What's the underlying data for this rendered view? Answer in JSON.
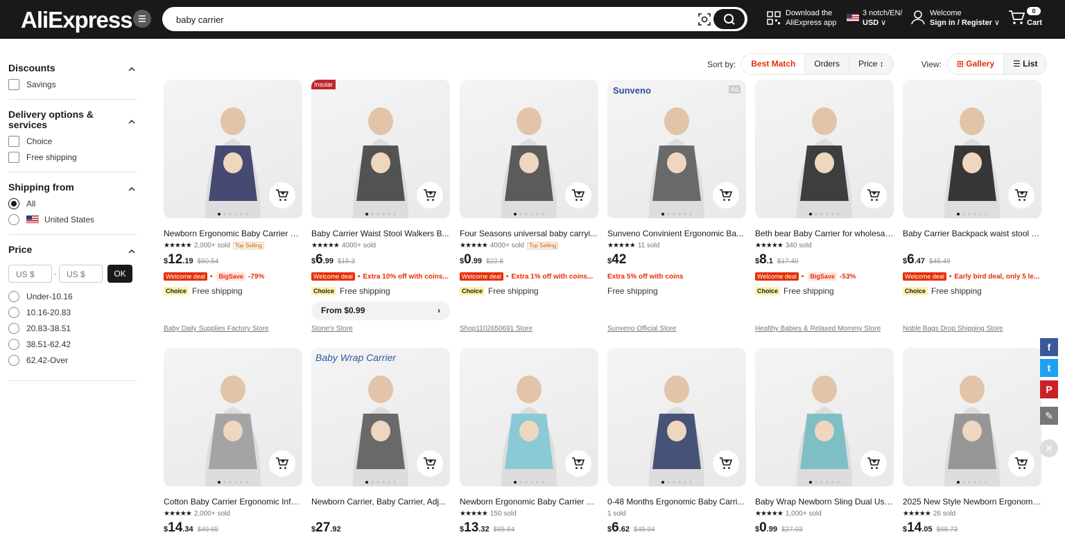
{
  "header": {
    "logo": "AliExpress",
    "search_value": "baby carrier",
    "download_line1": "Download the",
    "download_line2": "AliExpress app",
    "region_line1": "3 notch/EN/",
    "region_line2": "USD",
    "welcome_line1": "Welcome",
    "welcome_line2": "Sign in / Register",
    "cart_count": "0",
    "cart_label": "Cart"
  },
  "filters": {
    "discounts_title": "Discounts",
    "savings": "Savings",
    "delivery_title": "Delivery options & services",
    "choice": "Choice",
    "free_shipping": "Free shipping",
    "shipping_title": "Shipping from",
    "all": "All",
    "us": "United States",
    "price_title": "Price",
    "min_ph": "US $",
    "dash": "-",
    "max_ph": "US $",
    "ok": "OK",
    "ranges": [
      "Under-10.16",
      "10.16-20.83",
      "20.83-38.51",
      "38.51-62.42",
      "62.42-Over"
    ]
  },
  "sort": {
    "label": "Sort by:",
    "best": "Best Match",
    "orders": "Orders",
    "price": "Price",
    "view": "View:",
    "gallery": "Gallery",
    "list": "List"
  },
  "products": [
    {
      "title": "Newborn Ergonomic Baby Carrier B...",
      "sold": "2,000+ sold",
      "badge": "Top Selling",
      "cur": "$",
      "int": "12",
      "cent": ".19",
      "old": "$60.54",
      "promo": [
        "Welcome deal",
        "BigSave",
        "-79%"
      ],
      "ship": "Free shipping",
      "choice": "Choice",
      "store": "Baby Daily Supplies Factory Store",
      "accent": "#2b2f5e"
    },
    {
      "title": "Baby Carrier Waist Stool Walkers B...",
      "sold": "4000+ sold",
      "badge": "",
      "cur": "$",
      "int": "6",
      "cent": ".99",
      "old": "$15.3",
      "promo": [
        "Welcome deal",
        "",
        "Extra 10% off with coins..."
      ],
      "ship": "Free shipping",
      "choice": "Choice",
      "from": "From $0.99",
      "store": "Stone's Store",
      "accent": "#3a3a3a",
      "tag": "Insular"
    },
    {
      "title": "Four Seasons universal baby carryi...",
      "sold": "4000+ sold",
      "badge": "Top Selling",
      "cur": "$",
      "int": "0",
      "cent": ".99",
      "old": "$22.8",
      "promo": [
        "Welcome deal",
        "",
        "Extra 1% off with coins..."
      ],
      "ship": "Free shipping",
      "choice": "Choice",
      "store": "Shop1102650691 Store",
      "accent": "#444"
    },
    {
      "title": "Sunveno Convinient Ergonomic Ba...",
      "sold": "11 sold",
      "badge": "",
      "cur": "$",
      "int": "42",
      "cent": "",
      "old": "",
      "promo": [
        "",
        "",
        "Extra 5% off with coins"
      ],
      "ship": "Free shipping",
      "choice": "",
      "store": "Sunveno Official Store",
      "accent": "#555",
      "tag": "Sunveno",
      "ad": "Ad"
    },
    {
      "title": "Beth bear Baby Carrier for wholesal...",
      "sold": "340 sold",
      "badge": "",
      "cur": "$",
      "int": "8",
      "cent": ".1",
      "old": "$17.40",
      "promo": [
        "Welcome deal",
        "BigSave",
        "-53%"
      ],
      "ship": "Free shipping",
      "choice": "Choice",
      "store": "Healthy Babies & Relaxed Mommy Store",
      "accent": "#222"
    },
    {
      "title": "Baby Carrier Backpack waist stool s...",
      "sold": "",
      "badge": "",
      "cur": "$",
      "int": "6",
      "cent": ".47",
      "old": "$45.49",
      "promo": [
        "Welcome deal",
        "",
        "Early bird deal, only 5 le..."
      ],
      "ship": "Free shipping",
      "choice": "Choice",
      "store": "Noble Bags Drop Shipping Store",
      "accent": "#1a1a1a"
    },
    {
      "title": "Cotton Baby Carrier Ergonomic Infa...",
      "sold": "2,000+ sold",
      "badge": "",
      "cur": "$",
      "int": "14",
      "cent": ".34",
      "old": "$49.65",
      "accent": "#9a9a9a"
    },
    {
      "title": "Newborn Carrier, Baby Carrier, Adj...",
      "sold": "",
      "badge": "",
      "cur": "$",
      "int": "27",
      "cent": ".92",
      "old": "",
      "accent": "#555",
      "tag2": "Baby Wrap Carrier"
    },
    {
      "title": "Newborn Ergonomic Baby Carrier B...",
      "sold": "150 sold",
      "badge": "",
      "cur": "$",
      "int": "13",
      "cent": ".32",
      "old": "$65.64",
      "accent": "#7cc7d4"
    },
    {
      "title": "0-48 Months Ergonomic Baby Carri...",
      "sold": "1 sold",
      "badge": "",
      "cur": "$",
      "int": "6",
      "cent": ".62",
      "old": "$45.94",
      "accent": "#2b3a66"
    },
    {
      "title": "Baby Wrap Newborn Sling Dual Use...",
      "sold": "1,000+ sold",
      "badge": "",
      "cur": "$",
      "int": "0",
      "cent": ".99",
      "old": "$27.03",
      "accent": "#6cbac0"
    },
    {
      "title": "2025 New Style Newborn Ergonomi...",
      "sold": "26 sold",
      "badge": "",
      "cur": "$",
      "int": "14",
      "cent": ".05",
      "old": "$68.73",
      "accent": "#8a8a8a"
    }
  ],
  "colors": {
    "brand": "#e62e04",
    "dark": "#191919"
  }
}
